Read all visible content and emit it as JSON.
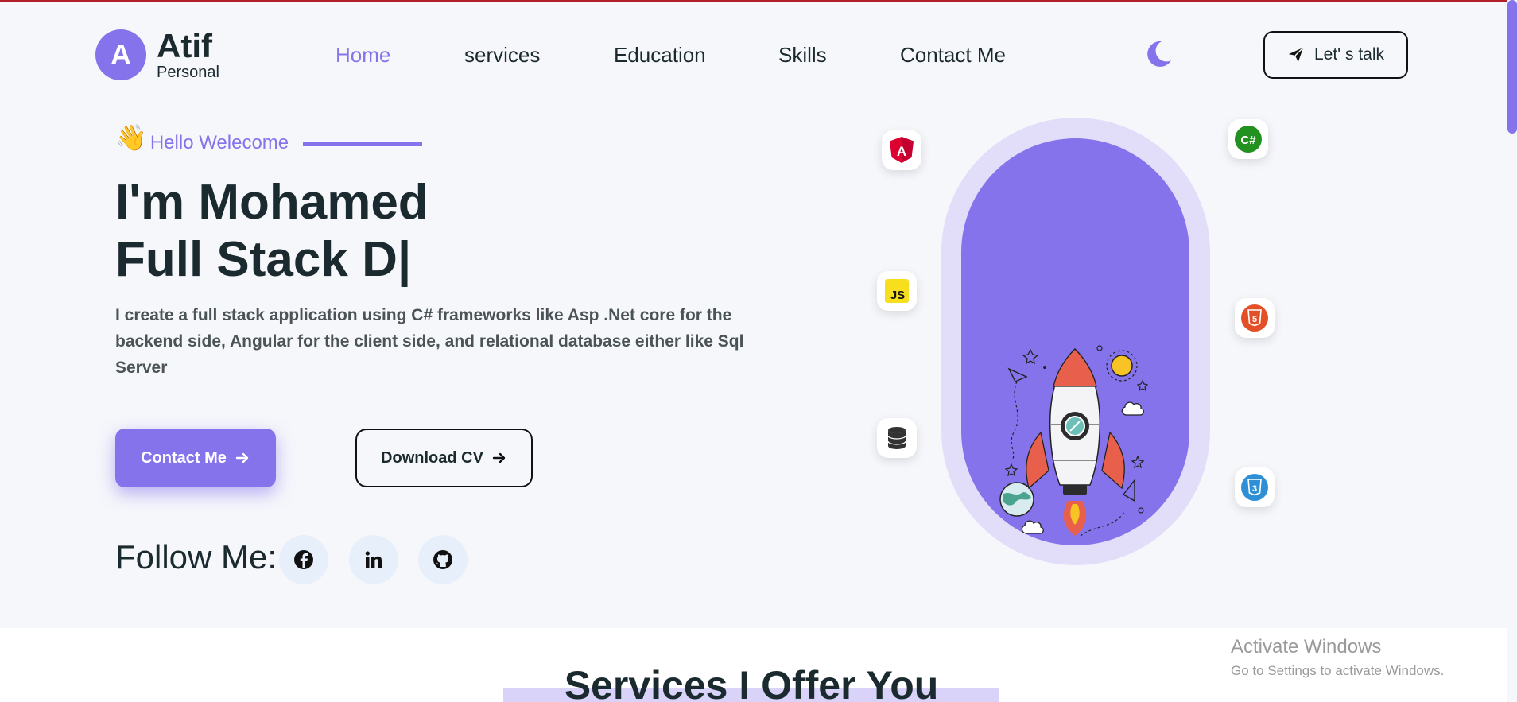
{
  "header": {
    "logo_letter": "A",
    "logo_name": "Atif",
    "logo_sub": "Personal",
    "nav": [
      {
        "label": "Home",
        "active": true
      },
      {
        "label": "services",
        "active": false
      },
      {
        "label": "Education",
        "active": false
      },
      {
        "label": "Skills",
        "active": false
      },
      {
        "label": "Contact Me",
        "active": false
      }
    ],
    "theme_icon": "moon-icon",
    "talk_label": "Let' s talk"
  },
  "hero": {
    "greeting_emoji": "👋",
    "greeting": "Hello Welecome",
    "line1": "I'm Mohamed",
    "line2": "Full Stack D|",
    "description": "I create a full stack application using C# frameworks like Asp .Net core for the backend side, Angular for the client side, and relational database either like Sql Server",
    "contact_label": "Contact Me",
    "cv_label": "Download CV",
    "follow_label": "Follow Me:",
    "socials": [
      "facebook-icon",
      "linkedin-icon",
      "github-icon"
    ]
  },
  "tech_icons": {
    "angular": "A",
    "csharp": "C#",
    "javascript": "JS",
    "html5": "5",
    "database": "database-icon",
    "css3": "3"
  },
  "services": {
    "title": "Services I Offer You"
  },
  "windows_notice": {
    "title": "Activate Windows",
    "subtitle": "Go to Settings to activate Windows."
  },
  "colors": {
    "accent": "#8573ec",
    "accent_light": "#e2def9",
    "text": "#1b2a2f",
    "bg": "#f6f7fb"
  }
}
